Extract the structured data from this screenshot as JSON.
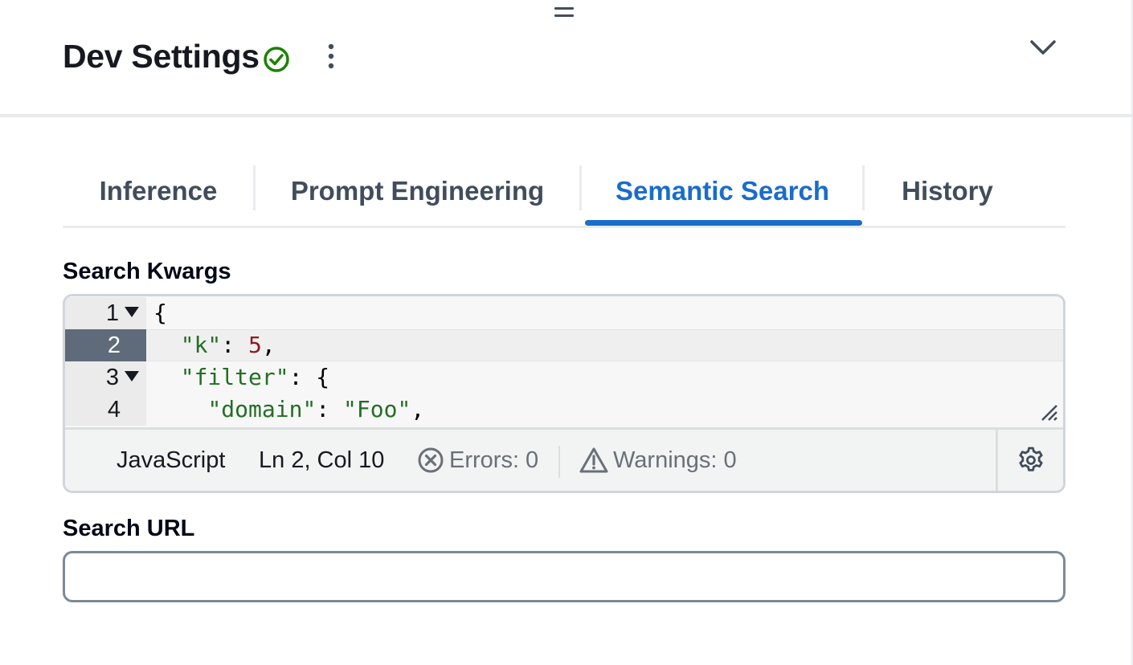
{
  "header": {
    "title": "Dev Settings",
    "status_icon": "check-circle-icon",
    "status_color": "#1d8102",
    "more_icon": "vertical-dots-icon",
    "collapse_icon": "chevron-down-icon"
  },
  "tabs": [
    {
      "label": "Inference",
      "active": false
    },
    {
      "label": "Prompt Engineering",
      "active": false
    },
    {
      "label": "Semantic Search",
      "active": true
    },
    {
      "label": "History",
      "active": false
    }
  ],
  "accent_color": "#1a6dc9",
  "search_kwargs": {
    "label": "Search Kwargs",
    "code_lines": [
      {
        "number": "1",
        "foldable": true,
        "active": false
      },
      {
        "number": "2",
        "foldable": false,
        "active": true
      },
      {
        "number": "3",
        "foldable": true,
        "active": false
      },
      {
        "number": "4",
        "foldable": false,
        "active": false
      }
    ],
    "code": {
      "line1": "{",
      "line2_key": "\"k\"",
      "line2_sep": ": ",
      "line2_value": "5",
      "line2_end": ",",
      "line3_key": "\"filter\"",
      "line3_rest": ": {",
      "line4_key": "\"domain\"",
      "line4_sep": ": ",
      "line4_value": "\"Foo\"",
      "line4_end": ","
    },
    "status_bar": {
      "language": "JavaScript",
      "cursor": "Ln 2, Col 10",
      "errors": "Errors: 0",
      "warnings": "Warnings: 0",
      "error_icon": "x-circle-icon",
      "warning_icon": "warning-triangle-icon",
      "settings_icon": "gear-icon"
    }
  },
  "search_url": {
    "label": "Search URL",
    "value": "",
    "placeholder": ""
  }
}
